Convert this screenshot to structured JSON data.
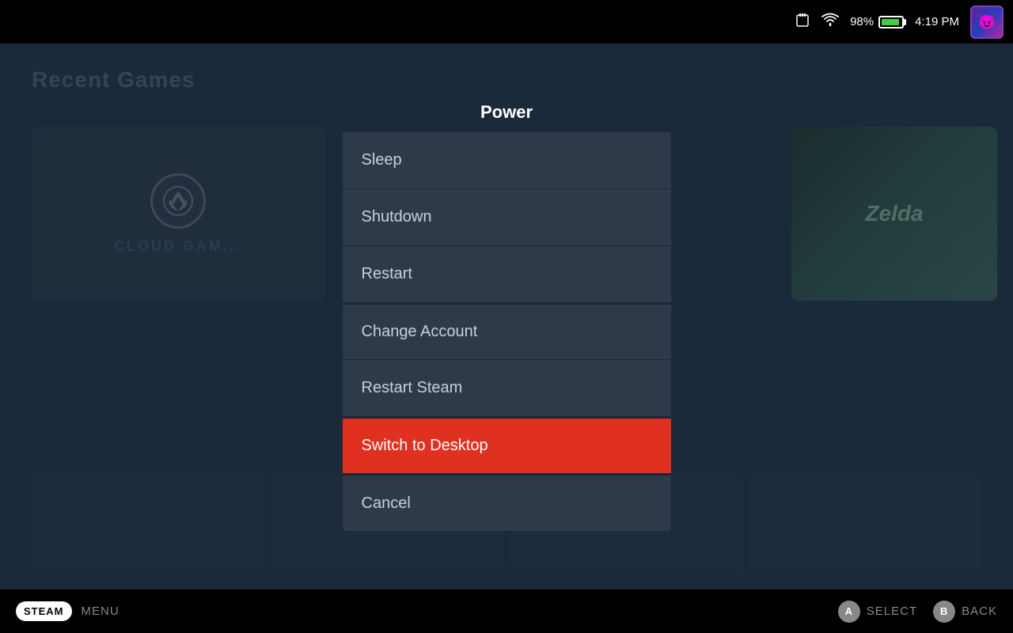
{
  "statusBar": {
    "battery_percent": "98%",
    "time": "4:19 PM"
  },
  "background": {
    "title": "Recent Games"
  },
  "modal": {
    "title": "Power",
    "items": [
      {
        "id": "sleep",
        "label": "Sleep",
        "highlighted": false,
        "divider": false
      },
      {
        "id": "shutdown",
        "label": "Shutdown",
        "highlighted": false,
        "divider": false
      },
      {
        "id": "restart",
        "label": "Restart",
        "highlighted": false,
        "divider": true
      },
      {
        "id": "change-account",
        "label": "Change Account",
        "highlighted": false,
        "divider": false
      },
      {
        "id": "restart-steam",
        "label": "Restart Steam",
        "highlighted": false,
        "divider": true
      },
      {
        "id": "switch-to-desktop",
        "label": "Switch to Desktop",
        "highlighted": true,
        "divider": false
      },
      {
        "id": "cancel",
        "label": "Cancel",
        "highlighted": false,
        "divider": true
      }
    ]
  },
  "bottomBar": {
    "steam_label": "STEAM",
    "menu_label": "MENU",
    "select_label": "SELECT",
    "back_label": "BACK",
    "a_button": "A",
    "b_button": "B"
  },
  "icons": {
    "sd_card": "🗂",
    "wifi": "📶",
    "avatar_emoji": "😈"
  }
}
